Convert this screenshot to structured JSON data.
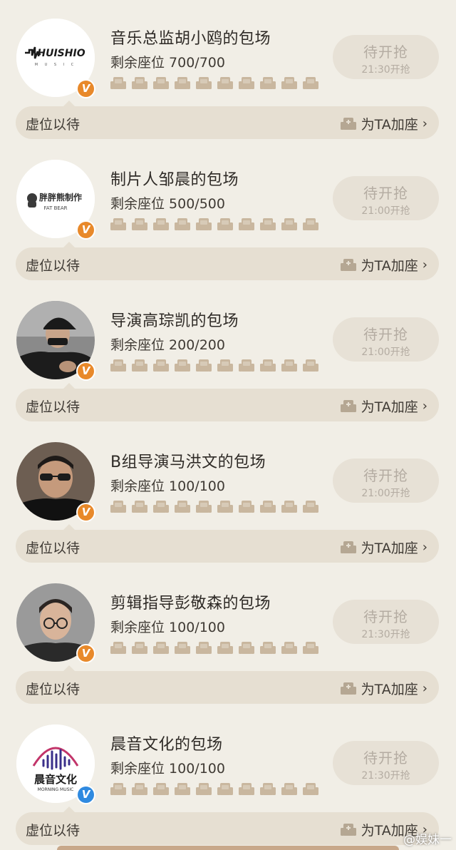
{
  "seat_icon_color": "#c9b79f",
  "wait_label": "虚位以待",
  "add_seat_label": "为TA加座",
  "cards": [
    {
      "title": "音乐总监胡小鸥的包场",
      "seats": "剩余座位 700/700",
      "btn_main": "待开抢",
      "btn_time": "21:30开抢",
      "avatar": "logo-huishiio",
      "avatar_text": "HUISHIO",
      "badge": "orange"
    },
    {
      "title": "制片人邹晨的包场",
      "seats": "剩余座位 500/500",
      "btn_main": "待开抢",
      "btn_time": "21:00开抢",
      "avatar": "logo-fatbear",
      "avatar_text": "胖胖熊制作",
      "avatar_sub": "FAT BEAR",
      "badge": "orange"
    },
    {
      "title": "导演高琮凯的包场",
      "seats": "剩余座位 200/200",
      "btn_main": "待开抢",
      "btn_time": "21:00开抢",
      "avatar": "photo-cap-man",
      "badge": "orange"
    },
    {
      "title": "B组导演马洪文的包场",
      "seats": "剩余座位 100/100",
      "btn_main": "待开抢",
      "btn_time": "21:00开抢",
      "avatar": "photo-glasses-man",
      "badge": "orange"
    },
    {
      "title": "剪辑指导彭敬森的包场",
      "seats": "剩余座位 100/100",
      "btn_main": "待开抢",
      "btn_time": "21:30开抢",
      "avatar": "photo-portrait-man",
      "badge": "orange"
    },
    {
      "title": "晨音文化的包场",
      "seats": "剩余座位 100/100",
      "btn_main": "待开抢",
      "btn_time": "21:30开抢",
      "avatar": "logo-morning-music",
      "avatar_text": "晨音文化",
      "avatar_sub": "MORNING MUSIC",
      "badge": "blue"
    }
  ],
  "watermark": "@娱妹一"
}
